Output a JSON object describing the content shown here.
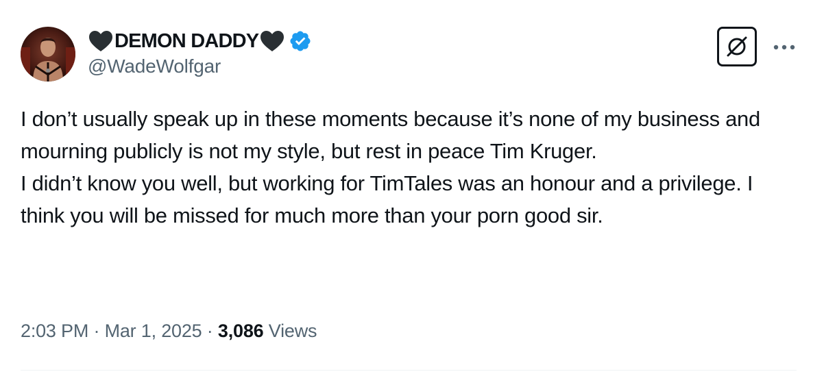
{
  "author": {
    "display_name": "DEMON DADDY",
    "handle": "@WadeWolfgar",
    "verified": true,
    "name_emoji": "black-heart",
    "verified_color": "#1d9bf0"
  },
  "actions": {
    "grok_icon": "grok-icon",
    "more_icon": "ellipsis-icon"
  },
  "tweet": {
    "text": "I don’t usually speak up in these moments because it’s none of my business and mourning publicly is not my style, but rest in peace Tim Kruger.\nI didn’t know you well, but working for TimTales was an honour and a privilege. I think you will be missed for much more than your porn good sir.",
    "time": "2:03 PM",
    "date": "Mar 1, 2025",
    "views_count": "3,086",
    "views_label": "Views",
    "separator": "·"
  },
  "colors": {
    "text": "#0f1419",
    "secondary": "#536471",
    "divider": "#eff3f4"
  }
}
